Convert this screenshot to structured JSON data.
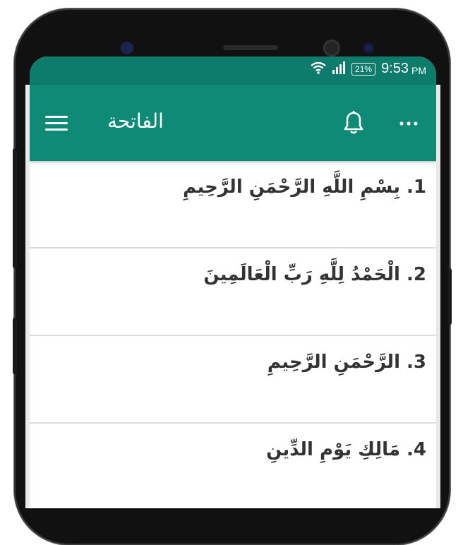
{
  "status_bar": {
    "time": "9:53",
    "ampm": "PM",
    "battery": "21%",
    "icons": [
      "wifi-icon",
      "signal-icon",
      "battery-icon"
    ]
  },
  "app_bar": {
    "title": "الفاتحة",
    "icons": [
      "menu-icon",
      "bell-icon",
      "more-icon"
    ],
    "color": "#0f8a77"
  },
  "verses": [
    {
      "text": "1. بِسْمِ اللَّهِ الرَّحْمَنِ الرَّحِيمِ"
    },
    {
      "text": "2. الْحَمْدُ لِلَّهِ رَبِّ الْعَالَمِينَ"
    },
    {
      "text": "3. الرَّحْمَنِ الرَّحِيمِ"
    },
    {
      "text": "4. مَالِكِ يَوْمِ الدِّينِ"
    }
  ]
}
